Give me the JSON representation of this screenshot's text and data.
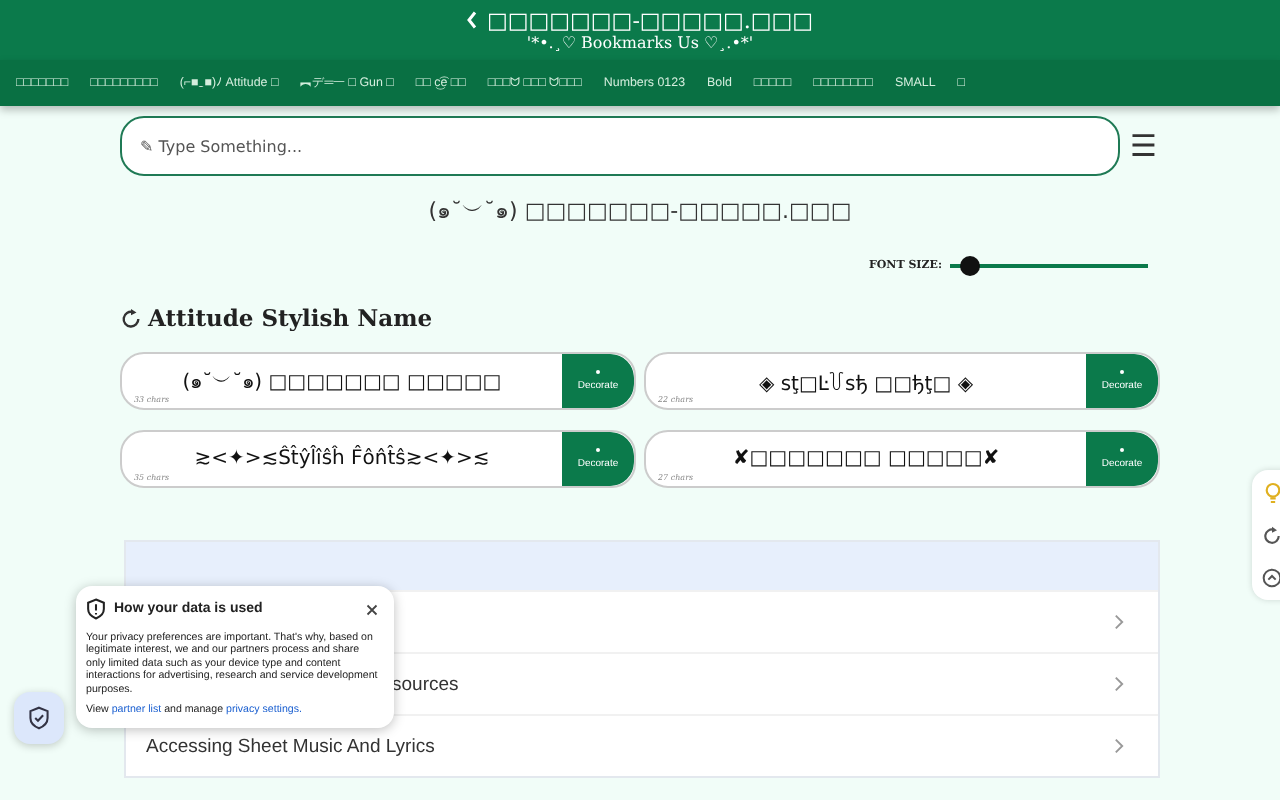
{
  "header": {
    "title": "□□□□□□□-□□□□□.□□□",
    "subtitle": "'*•.¸♡ Bookmarks Us ♡¸.•*'"
  },
  "nav": [
    {
      "label": "□□□□□□□"
    },
    {
      "label": "□□□□□□□□□"
    },
    {
      "label": "(⌐■‿■)ﾉ Attitude □"
    },
    {
      "label": "︻デ═一 □ Gun □"
    },
    {
      "label": "□□ c͜͡e □□"
    },
    {
      "label": "□□□ᗢ □□□ ᗢ□□□"
    },
    {
      "label": "Numbers 0123"
    },
    {
      "label": "Bold"
    },
    {
      "label": "□□□□□"
    },
    {
      "label": "□□□□□□□□"
    },
    {
      "label": "SMALL"
    },
    {
      "label": "□"
    }
  ],
  "search": {
    "placeholder": "✎ Type Something...",
    "menu": "☰"
  },
  "preview": "(๑˘︶˘๑) □□□□□□□-□□□□□.□□□",
  "font_size": {
    "label": "FONT SIZE:",
    "level": 0.1
  },
  "section_title": "Attitude Stylish Name",
  "cards": [
    {
      "text": "(๑˘︶˘๑) □□□□□□□ □□□□□",
      "count": "33 chars",
      "button": "Decorate"
    },
    {
      "text": "◈ sţ□Ŀ꒦sђ □□ђţ□ ◈",
      "count": "22 chars",
      "button": "Decorate"
    },
    {
      "text": "≳<✦>≲Ŝt̂ŷl̂îŝĥ F̂ôn̂t̂ŝ≳<✦>≲",
      "count": "35 chars",
      "button": "Decorate"
    },
    {
      "text": "✘□□□□□□□ □□□□□✘",
      "count": "27 chars",
      "button": "Decorate"
    }
  ],
  "list": {
    "rows": [
      {
        "kind": "hidden"
      },
      {
        "kind": "partial",
        "title": "sources"
      },
      {
        "kind": "full",
        "title": "Accessing Sheet Music And Lyrics"
      }
    ]
  },
  "privacy": {
    "title": "How your data is used",
    "body": "Your privacy preferences are important. That's why, based on legitimate interest, we and our partners process and share only limited data such as your device type and content interactions for advertising, research and service development purposes.",
    "footer_before": "View",
    "link1": "partner list",
    "footer_middle": "and manage",
    "link2": "privacy settings."
  }
}
